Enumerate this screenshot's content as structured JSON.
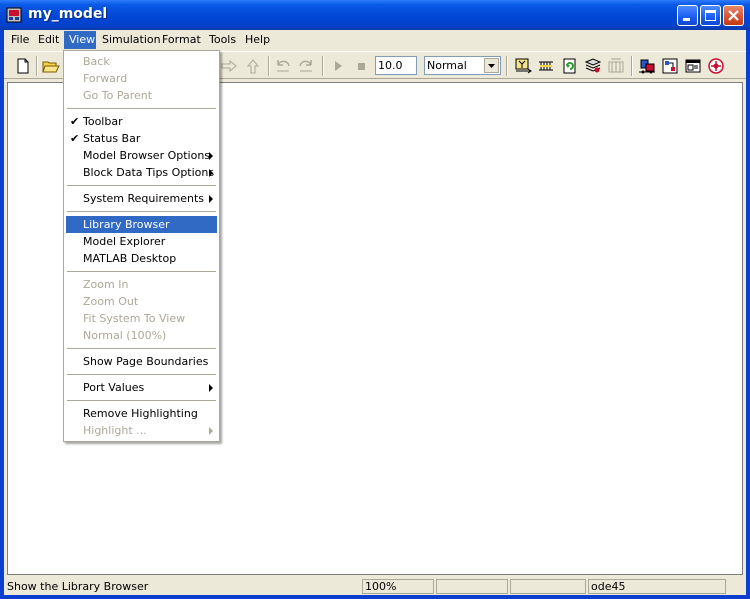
{
  "window": {
    "title": "my_model",
    "controls": [
      "minimize-icon",
      "maximize-icon",
      "close-icon"
    ]
  },
  "menubar": {
    "items": [
      "File",
      "Edit",
      "View",
      "Simulation",
      "Format",
      "Tools",
      "Help"
    ],
    "active": "View"
  },
  "toolbar": {
    "stop_time": "10.0",
    "sim_mode": "Normal",
    "icons": [
      "new-model-icon",
      "open-icon",
      "forward-icon",
      "go-to-parent-icon",
      "undo-icon",
      "redo-icon",
      "start-simulation-icon",
      "stop-simulation-icon",
      "build-icon",
      "update-diagram-icon",
      "refresh-icon",
      "library-browser-icon",
      "model-explorer-icon",
      "debug-icon",
      "toggle-model-browser-icon",
      "stateflow-icon"
    ]
  },
  "view_menu": {
    "items": [
      {
        "label": "Back",
        "enabled": false
      },
      {
        "label": "Forward",
        "enabled": false
      },
      {
        "label": "Go To Parent",
        "enabled": false
      },
      {
        "separator": true
      },
      {
        "label": "Toolbar",
        "checked": true
      },
      {
        "label": "Status Bar",
        "checked": true
      },
      {
        "label": "Model Browser Options",
        "submenu": true
      },
      {
        "label": "Block Data Tips Options",
        "submenu": true
      },
      {
        "separator": true
      },
      {
        "label": "System Requirements",
        "submenu": true
      },
      {
        "separator": true
      },
      {
        "label": "Library Browser",
        "highlighted": true
      },
      {
        "label": "Model Explorer"
      },
      {
        "label": "MATLAB Desktop"
      },
      {
        "separator": true
      },
      {
        "label": "Zoom In",
        "enabled": false
      },
      {
        "label": "Zoom Out",
        "enabled": false
      },
      {
        "label": "Fit System To View",
        "enabled": false
      },
      {
        "label": "Normal (100%)",
        "enabled": false
      },
      {
        "separator": true
      },
      {
        "label": "Show Page Boundaries"
      },
      {
        "separator": true
      },
      {
        "label": "Port Values",
        "submenu": true
      },
      {
        "separator": true
      },
      {
        "label": "Remove Highlighting"
      },
      {
        "label": "Highlight ...",
        "enabled": false,
        "submenu": true
      }
    ]
  },
  "statusbar": {
    "message": "Show the Library Browser",
    "zoom": "100%",
    "solver": "ode45"
  },
  "colors": {
    "titlebar": "#0a4fd8",
    "menu_highlight": "#316ac5",
    "chrome": "#ece9d8",
    "disabled_text": "#aca899"
  }
}
